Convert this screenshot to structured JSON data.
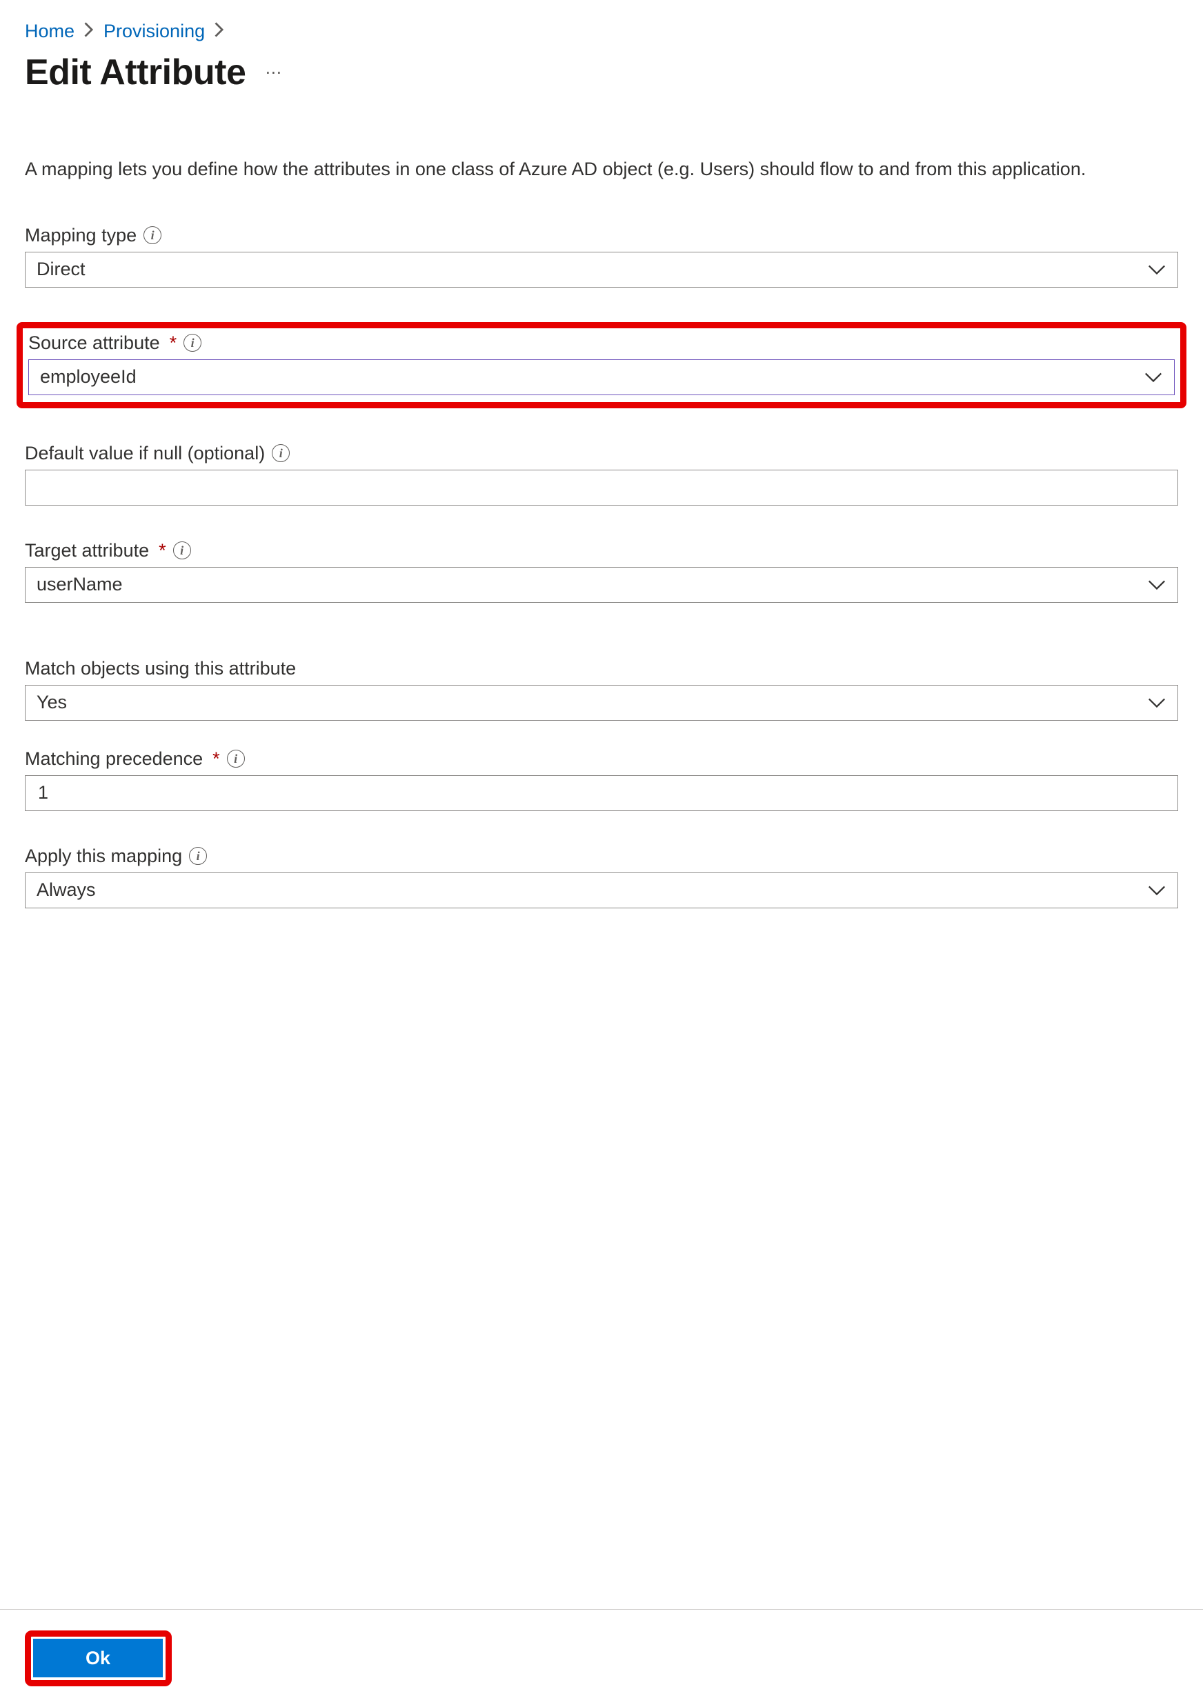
{
  "breadcrumb": {
    "home": "Home",
    "provisioning": "Provisioning"
  },
  "header": {
    "title": "Edit Attribute"
  },
  "description": "A mapping lets you define how the attributes in one class of Azure AD object (e.g. Users) should flow to and from this application.",
  "fields": {
    "mapping_type": {
      "label": "Mapping type",
      "value": "Direct"
    },
    "source_attribute": {
      "label": "Source attribute",
      "value": "employeeId"
    },
    "default_value": {
      "label": "Default value if null (optional)",
      "value": ""
    },
    "target_attribute": {
      "label": "Target attribute",
      "value": "userName"
    },
    "match_objects": {
      "label": "Match objects using this attribute",
      "value": "Yes"
    },
    "matching_precedence": {
      "label": "Matching precedence",
      "value": "1"
    },
    "apply_mapping": {
      "label": "Apply this mapping",
      "value": "Always"
    }
  },
  "footer": {
    "ok_label": "Ok"
  }
}
